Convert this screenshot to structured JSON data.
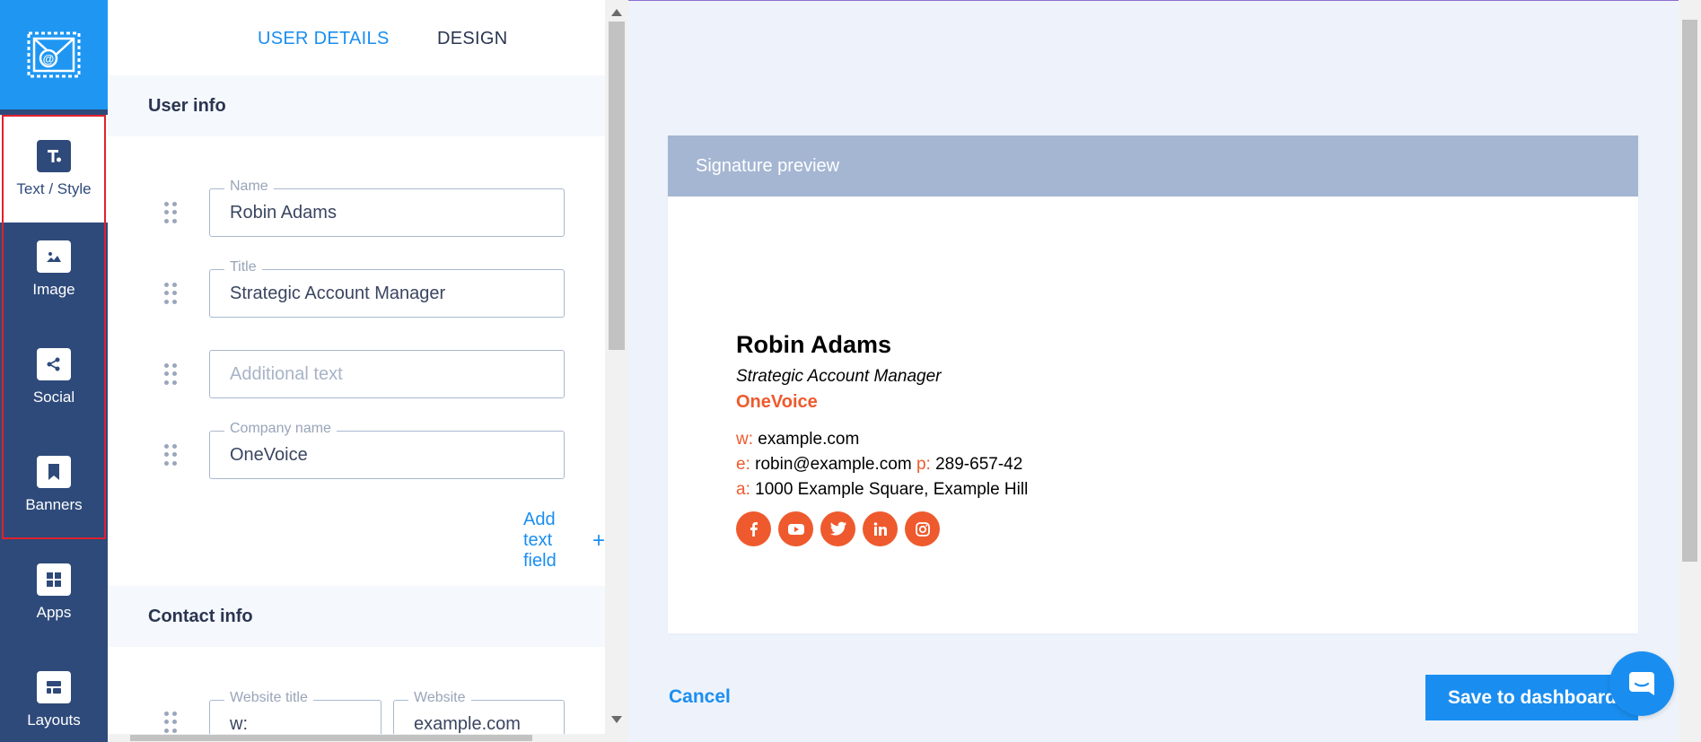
{
  "rail": {
    "items": [
      {
        "label": "Text / Style",
        "icon": "text-style-icon"
      },
      {
        "label": "Image",
        "icon": "image-icon"
      },
      {
        "label": "Social",
        "icon": "share-icon"
      },
      {
        "label": "Banners",
        "icon": "bookmark-icon"
      },
      {
        "label": "Apps",
        "icon": "apps-grid-icon"
      },
      {
        "label": "Layouts",
        "icon": "layouts-icon"
      }
    ],
    "active": "Text / Style"
  },
  "tabs": {
    "user_details": "USER DETAILS",
    "design": "DESIGN"
  },
  "user_info": {
    "heading": "User info",
    "fields": [
      {
        "label": "Name",
        "value": "Robin Adams",
        "placeholder": ""
      },
      {
        "label": "Title",
        "value": "Strategic Account Manager",
        "placeholder": ""
      },
      {
        "label": "",
        "value": "",
        "placeholder": "Additional text"
      },
      {
        "label": "Company name",
        "value": "OneVoice",
        "placeholder": ""
      }
    ],
    "add_field": "Add text field",
    "add_icon": "+"
  },
  "contact_info": {
    "heading": "Contact info",
    "website_title": {
      "label": "Website title",
      "value": "w:"
    },
    "website": {
      "label": "Website",
      "value": "example.com"
    }
  },
  "preview": {
    "header": "Signature preview",
    "name": "Robin Adams",
    "title": "Strategic Account Manager",
    "company": "OneVoice",
    "contacts": {
      "w_key": "w:",
      "w_val": "example.com",
      "e_key": "e:",
      "e_val": "robin@example.com",
      "p_key": "p:",
      "p_val": "289-657-42",
      "a_key": "a:",
      "a_val": "1000 Example Square, Example Hill"
    },
    "social_icons": [
      "facebook-icon",
      "youtube-icon",
      "twitter-icon",
      "linkedin-icon",
      "instagram-icon"
    ]
  },
  "actions": {
    "cancel": "Cancel",
    "save": "Save to dashboard"
  },
  "colors": {
    "accent": "#1a8ef0",
    "rail": "#2e4a7a",
    "brand_orange": "#ee5a2d",
    "preview_header": "#a5b6d3"
  }
}
